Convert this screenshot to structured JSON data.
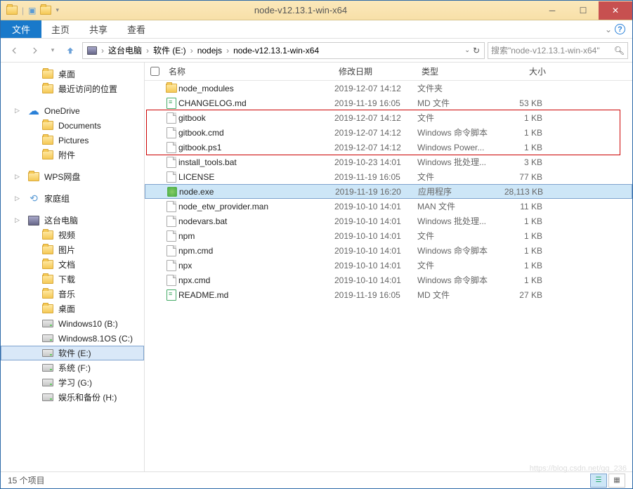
{
  "window": {
    "title": "node-v12.13.1-win-x64"
  },
  "ribbon": {
    "file": "文件",
    "tabs": [
      "主页",
      "共享",
      "查看"
    ]
  },
  "breadcrumb": {
    "items": [
      "这台电脑",
      "软件 (E:)",
      "nodejs",
      "node-v12.13.1-win-x64"
    ]
  },
  "search": {
    "placeholder": "搜索\"node-v12.13.1-win-x64\""
  },
  "sidebar": {
    "groups": [
      {
        "items": [
          {
            "label": "桌面",
            "icon": "folder",
            "depth": 1
          },
          {
            "label": "最近访问的位置",
            "icon": "folder",
            "depth": 1
          }
        ]
      },
      {
        "items": [
          {
            "label": "OneDrive",
            "icon": "cloud",
            "depth": 0,
            "caret": true
          },
          {
            "label": "Documents",
            "icon": "folder",
            "depth": 1
          },
          {
            "label": "Pictures",
            "icon": "folder",
            "depth": 1
          },
          {
            "label": "附件",
            "icon": "folder",
            "depth": 1
          }
        ]
      },
      {
        "items": [
          {
            "label": "WPS网盘",
            "icon": "folder",
            "depth": 0,
            "caret": true
          }
        ]
      },
      {
        "items": [
          {
            "label": "家庭组",
            "icon": "net",
            "depth": 0,
            "caret": true
          }
        ]
      },
      {
        "items": [
          {
            "label": "这台电脑",
            "icon": "pc",
            "depth": 0,
            "caret": true
          },
          {
            "label": "视频",
            "icon": "folder",
            "depth": 1
          },
          {
            "label": "图片",
            "icon": "folder",
            "depth": 1
          },
          {
            "label": "文档",
            "icon": "folder",
            "depth": 1
          },
          {
            "label": "下载",
            "icon": "folder",
            "depth": 1
          },
          {
            "label": "音乐",
            "icon": "folder",
            "depth": 1
          },
          {
            "label": "桌面",
            "icon": "folder",
            "depth": 1
          },
          {
            "label": "Windows10 (B:)",
            "icon": "drive",
            "depth": 1
          },
          {
            "label": "Windows8.1OS (C:)",
            "icon": "drive",
            "depth": 1
          },
          {
            "label": "软件 (E:)",
            "icon": "drive",
            "depth": 1,
            "selected": true
          },
          {
            "label": "系统 (F:)",
            "icon": "drive",
            "depth": 1
          },
          {
            "label": "学习 (G:)",
            "icon": "drive",
            "depth": 1
          },
          {
            "label": "娱乐和备份 (H:)",
            "icon": "drive",
            "depth": 1
          }
        ]
      }
    ]
  },
  "columns": {
    "name": "名称",
    "date": "修改日期",
    "type": "类型",
    "size": "大小"
  },
  "files": [
    {
      "name": "node_modules",
      "date": "2019-12-07 14:12",
      "type": "文件夹",
      "size": "",
      "icon": "folder"
    },
    {
      "name": "CHANGELOG.md",
      "date": "2019-11-19 16:05",
      "type": "MD 文件",
      "size": "53 KB",
      "icon": "md"
    },
    {
      "name": "gitbook",
      "date": "2019-12-07 14:12",
      "type": "文件",
      "size": "1 KB",
      "icon": "file"
    },
    {
      "name": "gitbook.cmd",
      "date": "2019-12-07 14:12",
      "type": "Windows 命令脚本",
      "size": "1 KB",
      "icon": "file"
    },
    {
      "name": "gitbook.ps1",
      "date": "2019-12-07 14:12",
      "type": "Windows Power...",
      "size": "1 KB",
      "icon": "file"
    },
    {
      "name": "install_tools.bat",
      "date": "2019-10-23 14:01",
      "type": "Windows 批处理...",
      "size": "3 KB",
      "icon": "file"
    },
    {
      "name": "LICENSE",
      "date": "2019-11-19 16:05",
      "type": "文件",
      "size": "77 KB",
      "icon": "file"
    },
    {
      "name": "node.exe",
      "date": "2019-11-19 16:20",
      "type": "应用程序",
      "size": "28,113 KB",
      "icon": "exe",
      "selected": true
    },
    {
      "name": "node_etw_provider.man",
      "date": "2019-10-10 14:01",
      "type": "MAN 文件",
      "size": "11 KB",
      "icon": "file"
    },
    {
      "name": "nodevars.bat",
      "date": "2019-10-10 14:01",
      "type": "Windows 批处理...",
      "size": "1 KB",
      "icon": "file"
    },
    {
      "name": "npm",
      "date": "2019-10-10 14:01",
      "type": "文件",
      "size": "1 KB",
      "icon": "file"
    },
    {
      "name": "npm.cmd",
      "date": "2019-10-10 14:01",
      "type": "Windows 命令脚本",
      "size": "1 KB",
      "icon": "file"
    },
    {
      "name": "npx",
      "date": "2019-10-10 14:01",
      "type": "文件",
      "size": "1 KB",
      "icon": "file"
    },
    {
      "name": "npx.cmd",
      "date": "2019-10-10 14:01",
      "type": "Windows 命令脚本",
      "size": "1 KB",
      "icon": "file"
    },
    {
      "name": "README.md",
      "date": "2019-11-19 16:05",
      "type": "MD 文件",
      "size": "27 KB",
      "icon": "md"
    }
  ],
  "status": {
    "count": "15 个项目"
  },
  "watermark": "https://blog.csdn.net/qq_236"
}
